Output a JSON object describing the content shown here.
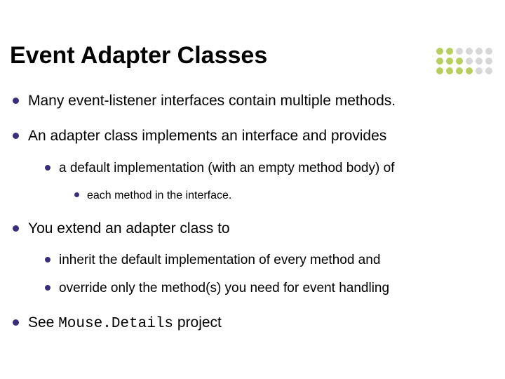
{
  "title": "Event Adapter Classes",
  "dots": [
    "#b7cf5f",
    "#b7cf5f",
    "#d7d7d7",
    "#d7d7d7",
    "#d7d7d7",
    "#d7d7d7",
    "#b7cf5f",
    "#b7cf5f",
    "#b7cf5f",
    "#d7d7d7",
    "#d7d7d7",
    "#d7d7d7",
    "#b7cf5f",
    "#b7cf5f",
    "#b7cf5f",
    "#b7cf5f",
    "#d7d7d7",
    "#d7d7d7"
  ],
  "bullets": {
    "b1": "Many event-listener interfaces contain multiple methods.",
    "b2": "An adapter class implements an interface and provides",
    "b2_1": "a default implementation (with an empty method body) of",
    "b2_1_1": "each method in the interface.",
    "b3": "You extend an adapter class to",
    "b3_1": "inherit the default implementation of every method and",
    "b3_2": "override only the method(s) you need for event handling",
    "b4_pre": "See ",
    "b4_code": "Mouse.Details",
    "b4_post": " project"
  }
}
